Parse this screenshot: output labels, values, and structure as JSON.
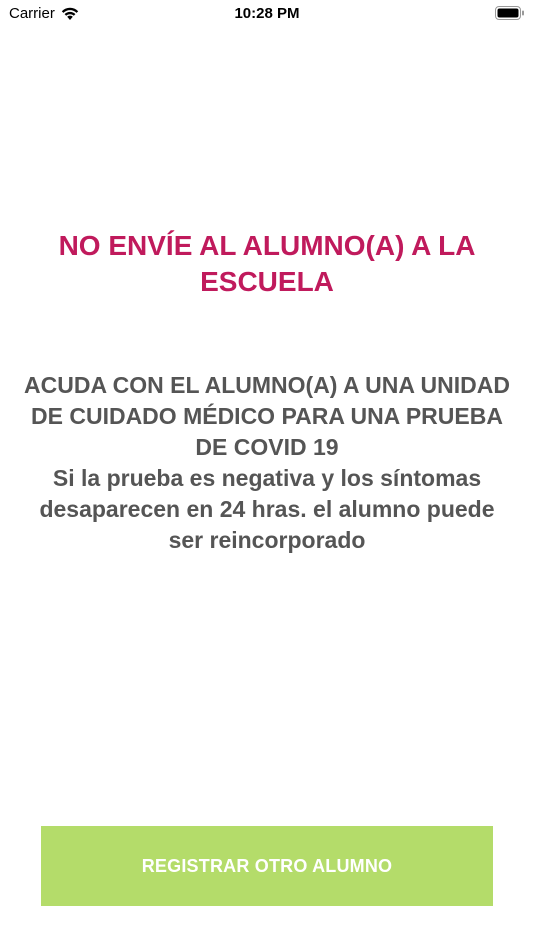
{
  "status_bar": {
    "carrier": "Carrier",
    "time": "10:28 PM",
    "icons": [
      "wifi-icon",
      "battery-icon"
    ]
  },
  "warning": {
    "title": "NO ENVÍE AL ALUMNO(A) A LA ESCUELA",
    "color": "#c01a5c"
  },
  "instructions": {
    "line1": "ACUDA CON EL ALUMNO(A) A UNA UNIDAD DE CUIDADO MÉDICO PARA UNA PRUEBA DE COVID 19",
    "line2": "Si la prueba es negativa y los síntomas desaparecen en 24 hras. el alumno puede ser reincorporado",
    "color": "#555555"
  },
  "actions": {
    "register_label": "REGISTRAR OTRO ALUMNO",
    "button_color": "#b4dc6a"
  }
}
